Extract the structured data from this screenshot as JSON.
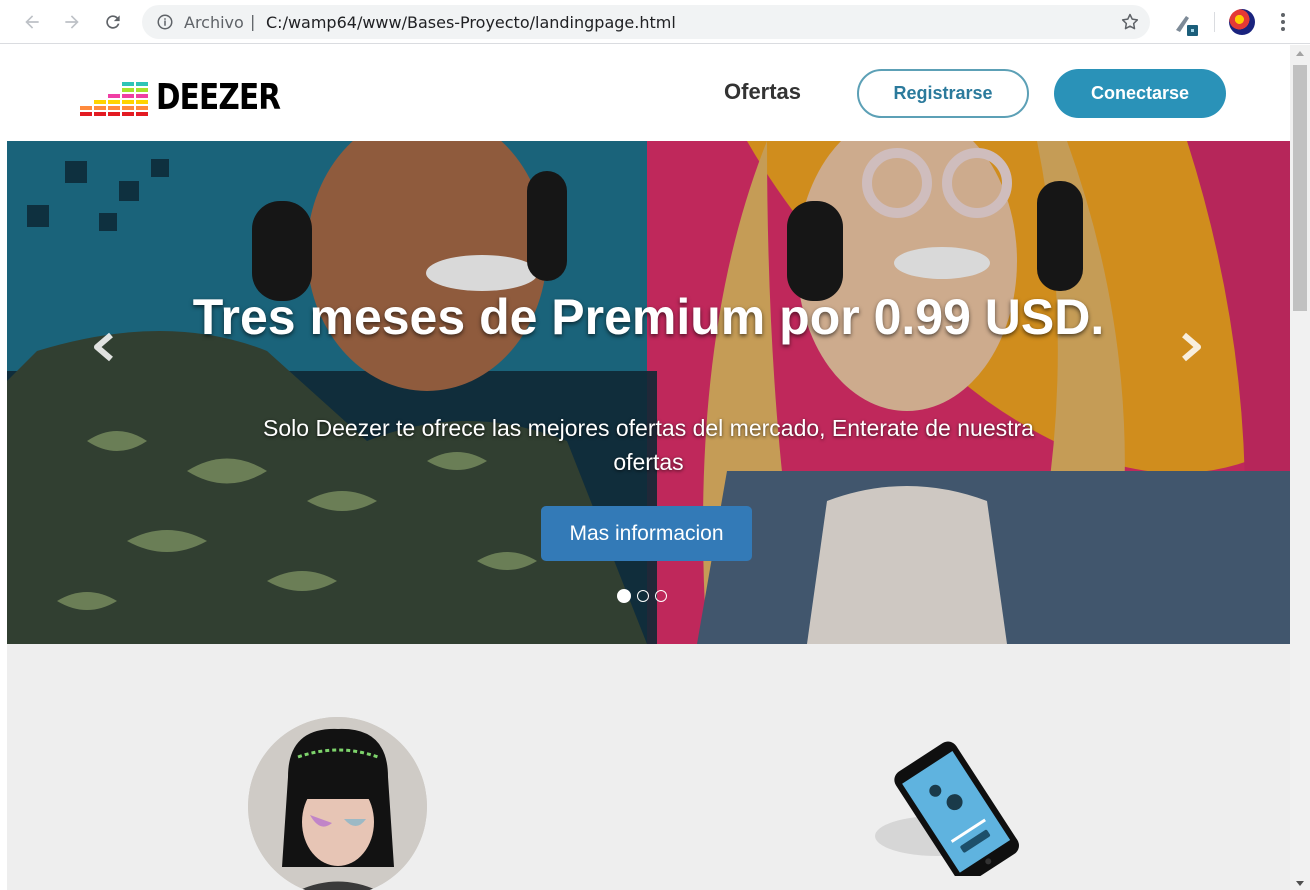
{
  "browser": {
    "scheme_label": "Archivo",
    "separator": "|",
    "url": "C:/wamp64/www/Bases-Proyecto/landingpage.html"
  },
  "navbar": {
    "logo_text": "DEEZER",
    "link_offers": "Ofertas",
    "register_label": "Registrarse",
    "login_label": "Conectarse"
  },
  "hero": {
    "title": "Tres meses de Premium por 0.99 USD.",
    "subtitle": "Solo Deezer te ofrece las mejores ofertas del mercado, Enterate de nuestra ofertas",
    "cta_label": "Mas informacion",
    "slide_count": 3,
    "active_slide": 1
  },
  "colors": {
    "brand_blue": "#2a92b8",
    "outline_blue": "#5ca0b6",
    "cta_blue": "#337ab7",
    "section_bg": "#eeeeee"
  }
}
